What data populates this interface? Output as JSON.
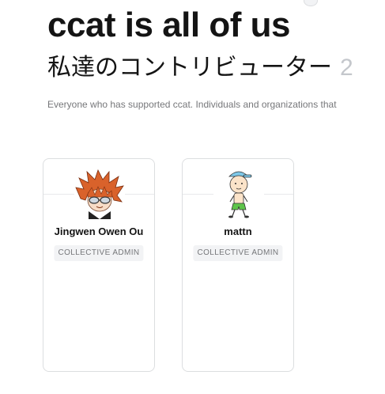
{
  "header": {
    "title": "ccat is all of us",
    "subtitle": "私達のコントリビューター",
    "contributor_count": "2",
    "description": "Everyone who has supported ccat. Individuals and organizations that"
  },
  "contributors": [
    {
      "name": "Jingwen Owen Ou",
      "role": "COLLECTIVE ADMIN",
      "avatar_icon": "spiky-orange-hair-avatar-icon"
    },
    {
      "name": "mattn",
      "role": "COLLECTIVE ADMIN",
      "avatar_icon": "cartoon-boy-avatar-icon"
    }
  ],
  "colors": {
    "text": "#141414",
    "muted": "#76777a",
    "count": "#c4c7cc",
    "border": "#dcdee0",
    "badge_bg": "#f2f3f5"
  }
}
